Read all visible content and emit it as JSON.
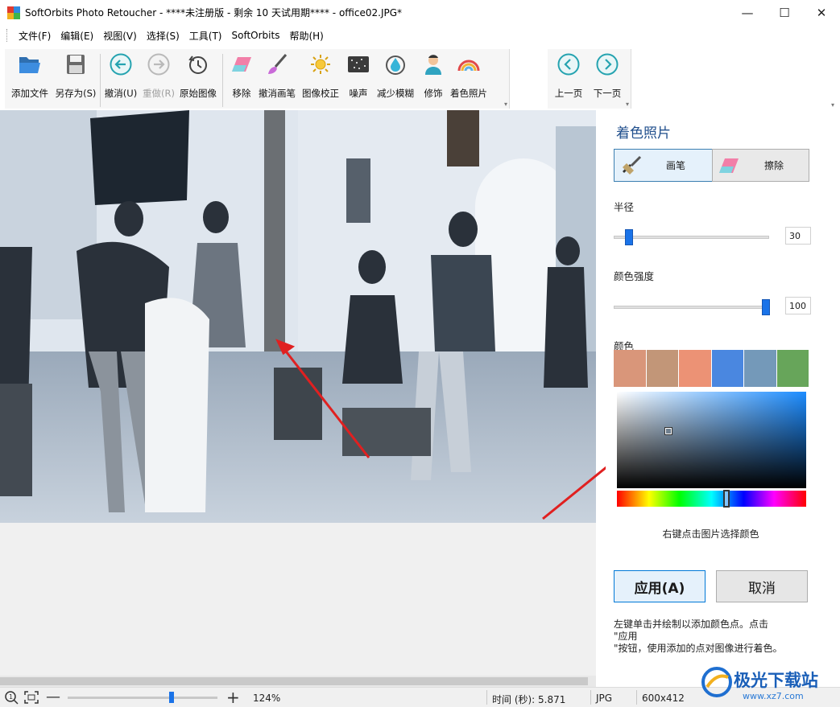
{
  "window": {
    "title": "SoftOrbits Photo Retoucher - ****未注册版 - 剩余 10 天试用期**** - office02.JPG*",
    "minimize": "—",
    "maximize": "☐",
    "close": "✕"
  },
  "menu": [
    "文件(F)",
    "编辑(E)",
    "视图(V)",
    "选择(S)",
    "工具(T)",
    "SoftOrbits",
    "帮助(H)"
  ],
  "toolbar": {
    "add_file": "添加文件",
    "save_as": "另存为(S)",
    "undo": "撤消(U)",
    "redo": "重做(R)",
    "original": "原始图像",
    "remove": "移除",
    "undo_brush": "撤消画笔",
    "correct": "图像校正",
    "noise": "噪声",
    "reduce_blur": "减少模糊",
    "retouch": "修饰",
    "colorize": "着色照片",
    "prev_page": "上一页",
    "next_page": "下一页"
  },
  "panel": {
    "title": "着色照片",
    "brush_label": "画笔",
    "erase_label": "擦除",
    "radius_label": "半径",
    "radius_value": "30",
    "radius_level": 0.07,
    "strength_label": "颜色强度",
    "strength_value": "100",
    "strength_level": 1.0,
    "color_label": "颜色",
    "swatches": [
      "#d9967a",
      "#c29678",
      "#ec9275",
      "#4a87e0",
      "#7499b9",
      "#67a55a"
    ],
    "right_click_hint": "右键点击图片选择颜色",
    "apply": "应用(A)",
    "cancel": "取消",
    "note": "左键单击并绘制以添加颜色点。点击\n\"应用\n\"按钮，使用添加的点对图像进行着色。"
  },
  "statusbar": {
    "zoom_percent": "124%",
    "time": "时间 (秒): 5.871",
    "format": "JPG",
    "dimensions": "600x412"
  },
  "watermark": {
    "text": "极光下载站",
    "url": "www.xz7.com"
  },
  "colors": {
    "accent": "#1a73e8",
    "title_blue": "#1f4e8c",
    "arrow_red": "#e02020"
  }
}
